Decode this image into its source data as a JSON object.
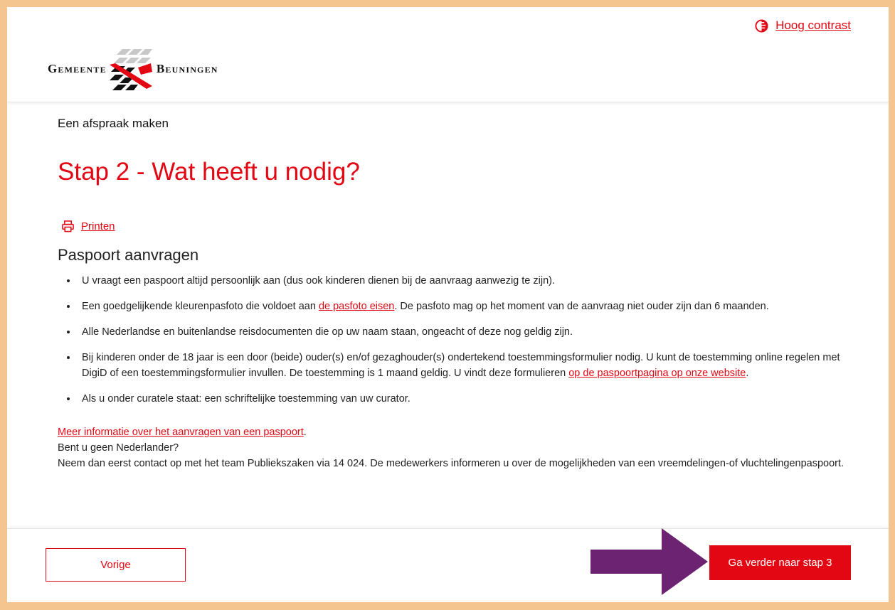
{
  "header": {
    "contrast_label": "Hoog contrast",
    "logo_left": "Gemeente",
    "logo_right": "Beuningen"
  },
  "main": {
    "breadcrumb": "Een afspraak maken",
    "title": "Stap 2 - Wat heeft u nodig?",
    "print_label": "Printen",
    "section_title": "Paspoort aanvragen",
    "bullets": {
      "b1": "U vraagt een paspoort altijd persoonlijk aan (dus ook kinderen dienen bij de aanvraag aanwezig te zijn).",
      "b2_before": "Een goedgelijkende kleurenpasfoto die voldoet aan ",
      "b2_link": "de pasfoto eisen",
      "b2_after": ". De pasfoto mag op het moment van de aanvraag niet ouder zijn dan 6 maanden.",
      "b3": "Alle Nederlandse en buitenlandse reisdocumenten die op uw naam staan, ongeacht of deze nog geldig zijn.",
      "b4_before": "Bij kinderen onder de 18 jaar is een door (beide) ouder(s) en/of gezaghouder(s) ondertekend toestemmingsformulier nodig. U kunt de toestemming online regelen met DigiD of een toestemmingsformulier invullen. De toestemming is 1 maand geldig. U vindt deze formulieren ",
      "b4_link": "op de paspoortpagina op onze website",
      "b4_after": ".",
      "b5": "Als u onder curatele staat: een schriftelijke toestemming van uw curator."
    },
    "more_link": "Meer informatie over het aanvragen van een paspoort",
    "more_link_after": ".",
    "foreigner_question": "Bent u geen Nederlander?",
    "foreigner_text": "Neem dan eerst contact op met het team Publiekszaken via 14 024. De medewerkers informeren u over de mogelijkheden van een vreemdelingen-of vluchtelingenpaspoort."
  },
  "footer": {
    "prev_label": "Vorige",
    "next_label": "Ga verder naar stap 3"
  },
  "colors": {
    "accent": "#e30613",
    "frame": "#f5c58f",
    "arrow": "#6b2372"
  }
}
